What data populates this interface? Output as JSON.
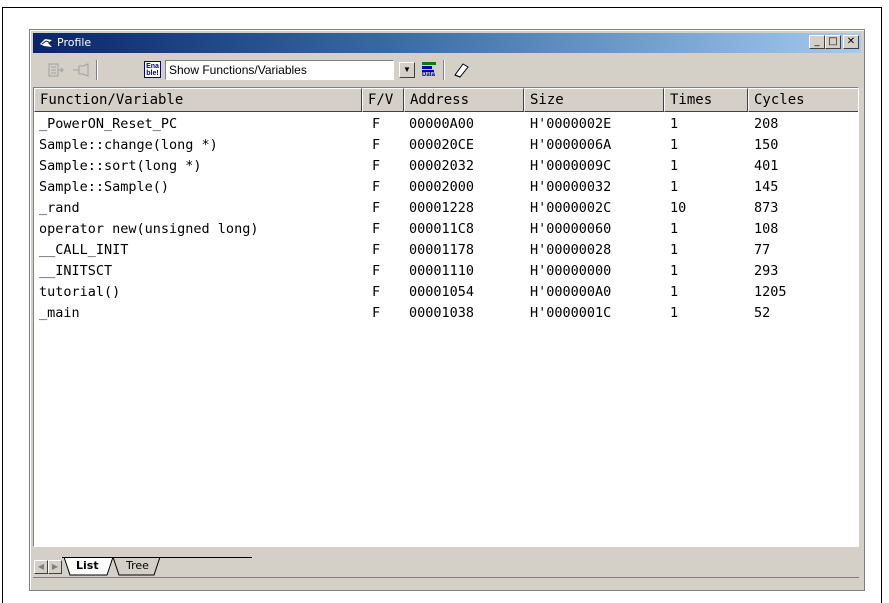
{
  "window": {
    "title": "Profile",
    "controls": {
      "minimize": "_",
      "maximize": "□",
      "close": "✕"
    }
  },
  "toolbar": {
    "enable_label_line1": "Ena",
    "enable_label_line2": "ble!",
    "display_select_value": "Show Functions/Variables",
    "data_label": "Data"
  },
  "table": {
    "headers": [
      "Function/Variable",
      "F/V",
      "Address",
      "Size",
      "Times",
      "Cycles"
    ],
    "rows": [
      [
        "_PowerON_Reset_PC",
        "F",
        "00000A00",
        "H'0000002E",
        "1",
        "208"
      ],
      [
        "Sample::change(long *)",
        "F",
        "000020CE",
        "H'0000006A",
        "1",
        "150"
      ],
      [
        "Sample::sort(long *)",
        "F",
        "00002032",
        "H'0000009C",
        "1",
        "401"
      ],
      [
        "Sample::Sample()",
        "F",
        "00002000",
        "H'00000032",
        "1",
        "145"
      ],
      [
        "_rand",
        "F",
        "00001228",
        "H'0000002C",
        "10",
        "873"
      ],
      [
        "operator new(unsigned long)",
        "F",
        "000011C8",
        "H'00000060",
        "1",
        "108"
      ],
      [
        "__CALL_INIT",
        "F",
        "00001178",
        "H'00000028",
        "1",
        "77"
      ],
      [
        "__INITSCT",
        "F",
        "00001110",
        "H'00000000",
        "1",
        "293"
      ],
      [
        "tutorial()",
        "F",
        "00001054",
        "H'000000A0",
        "1",
        "1205"
      ],
      [
        "_main",
        "F",
        "00001038",
        "H'0000001C",
        "1",
        "52"
      ]
    ]
  },
  "tabs": [
    "List",
    "Tree"
  ],
  "active_tab": "List"
}
